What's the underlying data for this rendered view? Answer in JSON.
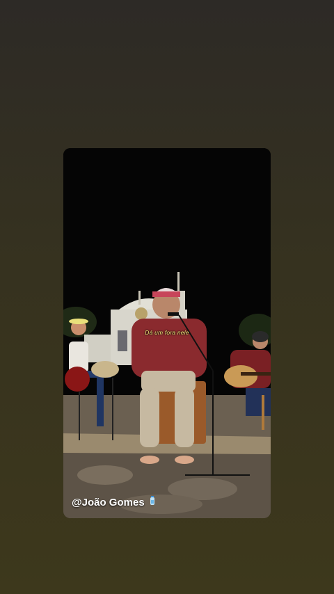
{
  "story": {
    "caption": "Dá um fora nele",
    "mention": "@João Gomes",
    "mention_icon": "water-bottle-icon"
  },
  "colors": {
    "background_top": "#2d2a26",
    "background_bottom": "#3d381c",
    "caption_color": "#f3e77a",
    "mention_color": "#ffffff"
  }
}
